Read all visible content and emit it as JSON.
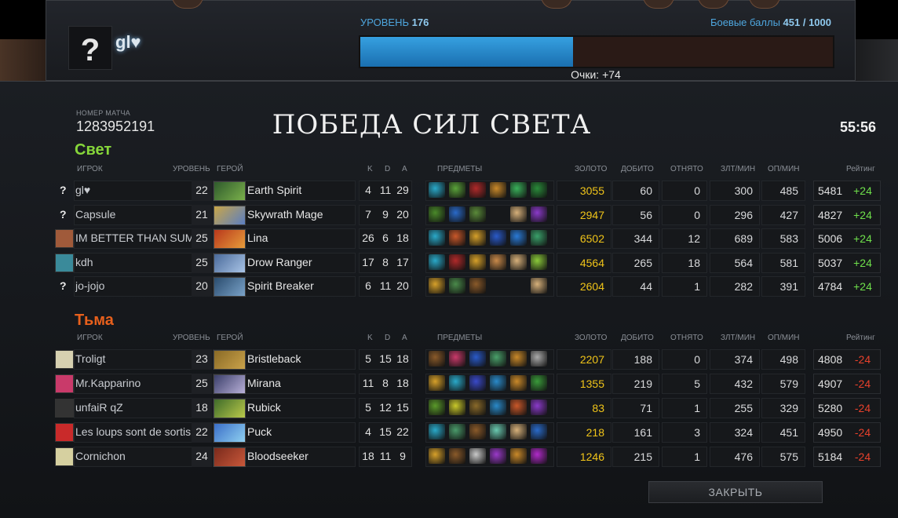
{
  "top": {
    "avatar": "?",
    "player_name": "gl♥",
    "level_label": "УРОВЕНЬ",
    "level_value": "176",
    "battle_points_label": "Боевые баллы",
    "battle_points_value": "451 / 1000",
    "xp_progress": 0.45,
    "points_text": "Очки: +74"
  },
  "match": {
    "id_label": "НОМЕР МАТЧА",
    "id": "1283952191",
    "result": "ПОБЕДА СИЛ СВЕТА",
    "duration": "55:56"
  },
  "headers": {
    "player": "ИГРОК",
    "level": "УРОВЕНЬ",
    "hero": "ГЕРОЙ",
    "k": "K",
    "d": "D",
    "a": "A",
    "items": "ПРЕДМЕТЫ",
    "gold": "ЗОЛОТО",
    "last_hits": "ДОБИТО",
    "denies": "ОТНЯТО",
    "gpm": "ЗЛТ/МИН",
    "xpm": "ОП/МИН",
    "rating": "Рейтинг"
  },
  "teams": {
    "radiant": {
      "title": "Свет",
      "color": "#86d63a",
      "players": [
        {
          "avatar": "?",
          "name": "gl♥",
          "level": "22",
          "hero": "Earth Spirit",
          "k": "4",
          "d": "11",
          "a": "29",
          "gold": "3055",
          "lh": "60",
          "dn": "0",
          "gpm": "300",
          "xpm": "485",
          "rating": "5481",
          "diff": "+24"
        },
        {
          "avatar": "?",
          "name": "Capsule",
          "level": "21",
          "hero": "Skywrath Mage",
          "k": "7",
          "d": "9",
          "a": "20",
          "gold": "2947",
          "lh": "56",
          "dn": "0",
          "gpm": "296",
          "xpm": "427",
          "rating": "4827",
          "diff": "+24"
        },
        {
          "avatar": "",
          "name": "IM BETTER THAN SUM",
          "level": "25",
          "hero": "Lina",
          "k": "26",
          "d": "6",
          "a": "18",
          "gold": "6502",
          "lh": "344",
          "dn": "12",
          "gpm": "689",
          "xpm": "583",
          "rating": "5006",
          "diff": "+24"
        },
        {
          "avatar": "",
          "name": "kdh",
          "level": "25",
          "hero": "Drow Ranger",
          "k": "17",
          "d": "8",
          "a": "17",
          "gold": "4564",
          "lh": "265",
          "dn": "18",
          "gpm": "564",
          "xpm": "581",
          "rating": "5037",
          "diff": "+24"
        },
        {
          "avatar": "?",
          "name": "jo-jojo",
          "level": "20",
          "hero": "Spirit Breaker",
          "k": "6",
          "d": "11",
          "a": "20",
          "gold": "2604",
          "lh": "44",
          "dn": "1",
          "gpm": "282",
          "xpm": "391",
          "rating": "4784",
          "diff": "+24"
        }
      ]
    },
    "dire": {
      "title": "Тьма",
      "color": "#e8601c",
      "players": [
        {
          "avatar": "",
          "name": "Troligt",
          "level": "23",
          "hero": "Bristleback",
          "k": "5",
          "d": "15",
          "a": "18",
          "gold": "2207",
          "lh": "188",
          "dn": "0",
          "gpm": "374",
          "xpm": "498",
          "rating": "4808",
          "diff": "-24"
        },
        {
          "avatar": "",
          "name": "Mr.Kapparino",
          "level": "25",
          "hero": "Mirana",
          "k": "11",
          "d": "8",
          "a": "18",
          "gold": "1355",
          "lh": "219",
          "dn": "5",
          "gpm": "432",
          "xpm": "579",
          "rating": "4907",
          "diff": "-24"
        },
        {
          "avatar": "",
          "name": "unfaiR qZ",
          "level": "18",
          "hero": "Rubick",
          "k": "5",
          "d": "12",
          "a": "15",
          "gold": "83",
          "lh": "71",
          "dn": "1",
          "gpm": "255",
          "xpm": "329",
          "rating": "5280",
          "diff": "-24"
        },
        {
          "avatar": "",
          "name": "Les loups sont de sortis",
          "level": "22",
          "hero": "Puck",
          "k": "4",
          "d": "15",
          "a": "22",
          "gold": "218",
          "lh": "161",
          "dn": "3",
          "gpm": "324",
          "xpm": "451",
          "rating": "4950",
          "diff": "-24"
        },
        {
          "avatar": "",
          "name": "Cornichon",
          "level": "24",
          "hero": "Bloodseeker",
          "k": "18",
          "d": "11",
          "a": "9",
          "gold": "1246",
          "lh": "215",
          "dn": "1",
          "gpm": "476",
          "xpm": "575",
          "rating": "5184",
          "diff": "-24"
        }
      ]
    }
  },
  "close_label": "ЗАКРЫТЬ"
}
